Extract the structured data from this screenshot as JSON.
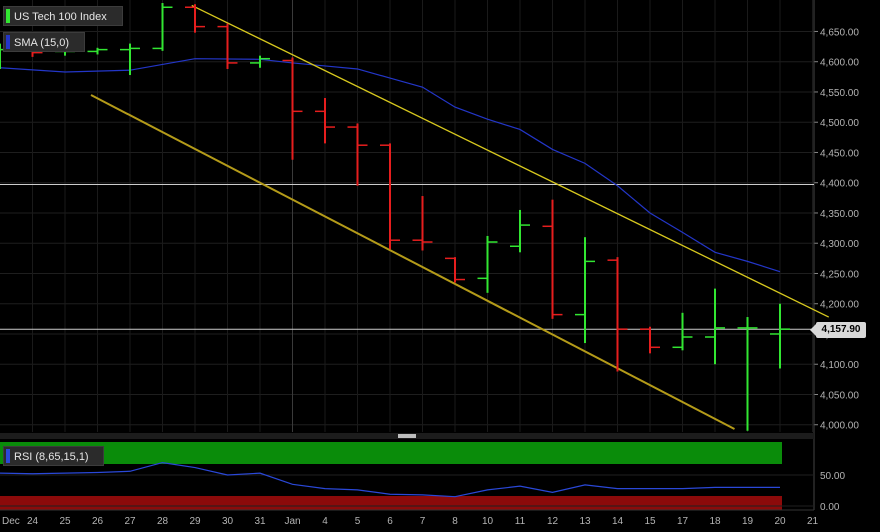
{
  "legend": {
    "main_label": "US Tech 100 Index",
    "sma_label": "SMA (15,0)",
    "rsi_label": "RSI (8,65,15,1)"
  },
  "last_price_label": "4,157.90",
  "colors": {
    "up": "#32e632",
    "down": "#e61e1e",
    "sma": "#2336c8",
    "channel_upper": "#d7c81e",
    "channel_lower": "#b49b19",
    "rsi_line": "#2a48d8",
    "rsi_top_zone": "#0a8c0a",
    "rsi_bottom_zone": "#8c0a0a",
    "hline": "#cccccc"
  },
  "chart_data": {
    "type": "ohlc",
    "x_labels": [
      "Dec",
      "24",
      "25",
      "26",
      "27",
      "28",
      "29",
      "30",
      "31",
      "Jan",
      "4",
      "5",
      "6",
      "7",
      "8",
      "10",
      "11",
      "12",
      "13",
      "14",
      "15",
      "17",
      "18",
      "19",
      "20",
      "21"
    ],
    "y_ticks": [
      4000,
      4050,
      4100,
      4150,
      4200,
      4250,
      4300,
      4350,
      4400,
      4450,
      4500,
      4550,
      4600,
      4650
    ],
    "y_tick_labels": [
      "4,000.00",
      "4,050.00",
      "4,100.00",
      "4,150.00",
      "4,200.00",
      "4,250.00",
      "4,300.00",
      "4,350.00",
      "4,400.00",
      "4,450.00",
      "4,500.00",
      "4,550.00",
      "4,600.00",
      "4,650.00"
    ],
    "ylim": [
      3988,
      4702
    ],
    "last_price": 4157.9,
    "horizontal_lines": [
      4397,
      4157.9
    ],
    "bars": [
      {
        "x": 0,
        "o": 4595,
        "h": 4630,
        "l": 4588,
        "c": 4620
      },
      {
        "x": 1,
        "o": 4620,
        "h": 4632,
        "l": 4608,
        "c": 4615
      },
      {
        "x": 2,
        "o": 4617,
        "h": 4625,
        "l": 4610,
        "c": 4617
      },
      {
        "x": 3,
        "o": 4617,
        "h": 4623,
        "l": 4612,
        "c": 4620
      },
      {
        "x": 4,
        "o": 4620,
        "h": 4630,
        "l": 4578,
        "c": 4622
      },
      {
        "x": 5,
        "o": 4622,
        "h": 4697,
        "l": 4618,
        "c": 4690
      },
      {
        "x": 6,
        "o": 4690,
        "h": 4695,
        "l": 4648,
        "c": 4658
      },
      {
        "x": 7,
        "o": 4658,
        "h": 4663,
        "l": 4588,
        "c": 4598
      },
      {
        "x": 8,
        "o": 4598,
        "h": 4610,
        "l": 4590,
        "c": 4605
      },
      {
        "x": 9,
        "o": 4602,
        "h": 4607,
        "l": 4438,
        "c": 4518
      },
      {
        "x": 10,
        "o": 4518,
        "h": 4540,
        "l": 4465,
        "c": 4492
      },
      {
        "x": 11,
        "o": 4492,
        "h": 4498,
        "l": 4395,
        "c": 4462
      },
      {
        "x": 12,
        "o": 4462,
        "h": 4465,
        "l": 4290,
        "c": 4305
      },
      {
        "x": 13,
        "o": 4305,
        "h": 4378,
        "l": 4288,
        "c": 4302
      },
      {
        "x": 14,
        "o": 4275,
        "h": 4277,
        "l": 4235,
        "c": 4240
      },
      {
        "x": 15,
        "o": 4242,
        "h": 4312,
        "l": 4218,
        "c": 4302
      },
      {
        "x": 16,
        "o": 4295,
        "h": 4355,
        "l": 4285,
        "c": 4330
      },
      {
        "x": 17,
        "o": 4328,
        "h": 4372,
        "l": 4175,
        "c": 4182
      },
      {
        "x": 18,
        "o": 4182,
        "h": 4310,
        "l": 4135,
        "c": 4270
      },
      {
        "x": 19,
        "o": 4272,
        "h": 4277,
        "l": 4088,
        "c": 4158
      },
      {
        "x": 20,
        "o": 4158,
        "h": 4162,
        "l": 4118,
        "c": 4128
      },
      {
        "x": 21,
        "o": 4128,
        "h": 4185,
        "l": 4123,
        "c": 4145
      },
      {
        "x": 22,
        "o": 4145,
        "h": 4225,
        "l": 4100,
        "c": 4160
      },
      {
        "x": 23,
        "o": 4160,
        "h": 4178,
        "l": 3990,
        "c": 4160
      },
      {
        "x": 24,
        "o": 4150,
        "h": 4200,
        "l": 4093,
        "c": 4158
      }
    ],
    "sma_series": {
      "x": [
        0,
        2,
        4,
        6,
        8,
        9,
        10,
        11,
        12,
        13,
        14,
        15,
        16,
        17,
        18,
        19,
        20,
        21,
        22,
        23,
        24
      ],
      "values": [
        4590,
        4583,
        4586,
        4605,
        4604,
        4598,
        4593,
        4588,
        4573,
        4558,
        4525,
        4505,
        4488,
        4455,
        4432,
        4395,
        4350,
        4318,
        4285,
        4270,
        4253
      ]
    },
    "channel_upper": {
      "x": [
        5.9,
        25.5
      ],
      "y": [
        4693,
        4178
      ]
    },
    "channel_lower": {
      "x": [
        2.8,
        22.6
      ],
      "y": [
        4545,
        3993
      ]
    },
    "rsi": {
      "ylim": [
        0,
        100
      ],
      "y_ticks": [
        0,
        50
      ],
      "y_tick_labels": [
        "0.00",
        "50.00"
      ],
      "x": [
        -1,
        0,
        1,
        2,
        3,
        4,
        5,
        6,
        7,
        8,
        9,
        10,
        11,
        12,
        13,
        14,
        15,
        16,
        17,
        18,
        19,
        20,
        21,
        22,
        23,
        24
      ],
      "values": [
        52,
        53,
        52,
        53,
        54,
        56,
        70,
        62,
        50,
        53,
        35,
        28,
        26,
        19,
        18,
        15,
        26,
        32,
        22,
        34,
        28,
        28,
        28,
        30,
        30,
        30
      ]
    }
  }
}
